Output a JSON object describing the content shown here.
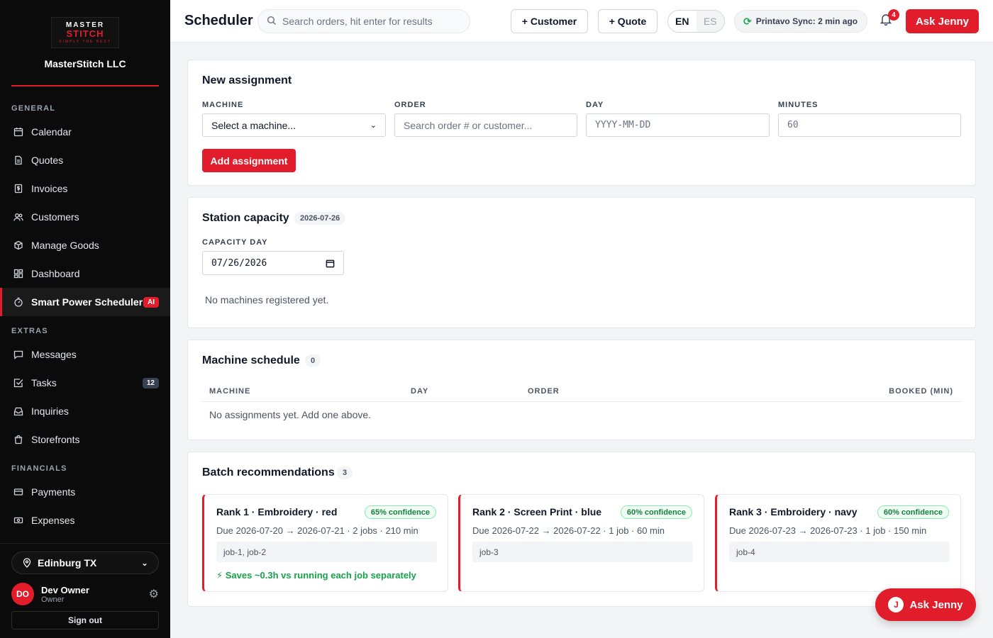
{
  "brand": {
    "logo_top": "MASTER",
    "logo_main": "STITCH",
    "logo_sub": "SIMPLY THE BEST",
    "name": "MasterStitch LLC"
  },
  "sidebar": {
    "sections": {
      "general": "GENERAL",
      "extras": "EXTRAS",
      "financials": "FINANCIALS"
    },
    "items": [
      {
        "label": "Calendar",
        "icon": "calendar-icon"
      },
      {
        "label": "Quotes",
        "icon": "document-icon"
      },
      {
        "label": "Invoices",
        "icon": "dollar-file-icon"
      },
      {
        "label": "Customers",
        "icon": "users-icon"
      },
      {
        "label": "Manage Goods",
        "icon": "box-icon"
      },
      {
        "label": "Dashboard",
        "icon": "grid-icon"
      },
      {
        "label": "Smart Power Scheduler",
        "icon": "timer-icon",
        "badge": "AI",
        "active": true
      },
      {
        "label": "Messages",
        "icon": "message-icon"
      },
      {
        "label": "Tasks",
        "icon": "checkbox-icon",
        "badge": "12"
      },
      {
        "label": "Inquiries",
        "icon": "inbox-icon"
      },
      {
        "label": "Storefronts",
        "icon": "store-icon"
      },
      {
        "label": "Payments",
        "icon": "card-icon"
      },
      {
        "label": "Expenses",
        "icon": "cash-icon"
      }
    ],
    "location": "Edinburg TX",
    "user": {
      "initials": "DO",
      "name": "Dev Owner",
      "role": "Owner"
    },
    "sign_out": "Sign out"
  },
  "header": {
    "title": "Scheduler",
    "search_placeholder": "Search orders, hit enter for results",
    "customer_btn": "+ Customer",
    "quote_btn": "+ Quote",
    "lang_en": "EN",
    "lang_es": "ES",
    "sync": "Printavo Sync: 2 min ago",
    "notifications": "4",
    "ask": "Ask Jenny"
  },
  "assignment": {
    "title": "New assignment",
    "machine_label": "MACHINE",
    "machine_value": "Select a machine...",
    "order_label": "ORDER",
    "order_placeholder": "Search order # or customer...",
    "day_label": "DAY",
    "day_placeholder": "YYYY-MM-DD",
    "minutes_label": "MINUTES",
    "minutes_value": "60",
    "add_btn": "Add assignment"
  },
  "capacity": {
    "title": "Station capacity",
    "date_pill": "2026-07-26",
    "day_label": "CAPACITY DAY",
    "day_value": "07/26/2026",
    "empty": "No machines registered yet."
  },
  "schedule": {
    "title": "Machine schedule",
    "count": "0",
    "columns": [
      "MACHINE",
      "DAY",
      "ORDER",
      "BOOKED (MIN)"
    ],
    "empty": "No assignments yet. Add one above."
  },
  "batch": {
    "title": "Batch recommendations",
    "count": "3",
    "items": [
      {
        "title": "Rank 1 · Embroidery · red",
        "confidence": "65% confidence",
        "meta": "Due 2026-07-20 → 2026-07-21 · 2 jobs · 210 min",
        "jobs": "job-1, job-2",
        "savings": "⚡ Saves ~0.3h vs running each job separately"
      },
      {
        "title": "Rank 2 · Screen Print · blue",
        "confidence": "60% confidence",
        "meta": "Due 2026-07-22 → 2026-07-22 · 1 job · 60 min",
        "jobs": "job-3",
        "savings": ""
      },
      {
        "title": "Rank 3 · Embroidery · navy",
        "confidence": "60% confidence",
        "meta": "Due 2026-07-23 → 2026-07-23 · 1 job · 150 min",
        "jobs": "job-4",
        "savings": ""
      }
    ]
  },
  "fab": {
    "label": "Ask Jenny",
    "initial": "J"
  },
  "colors": {
    "accent": "#e11d2b",
    "sidebar_bg": "#0b0b0b",
    "success": "#16a34a"
  }
}
